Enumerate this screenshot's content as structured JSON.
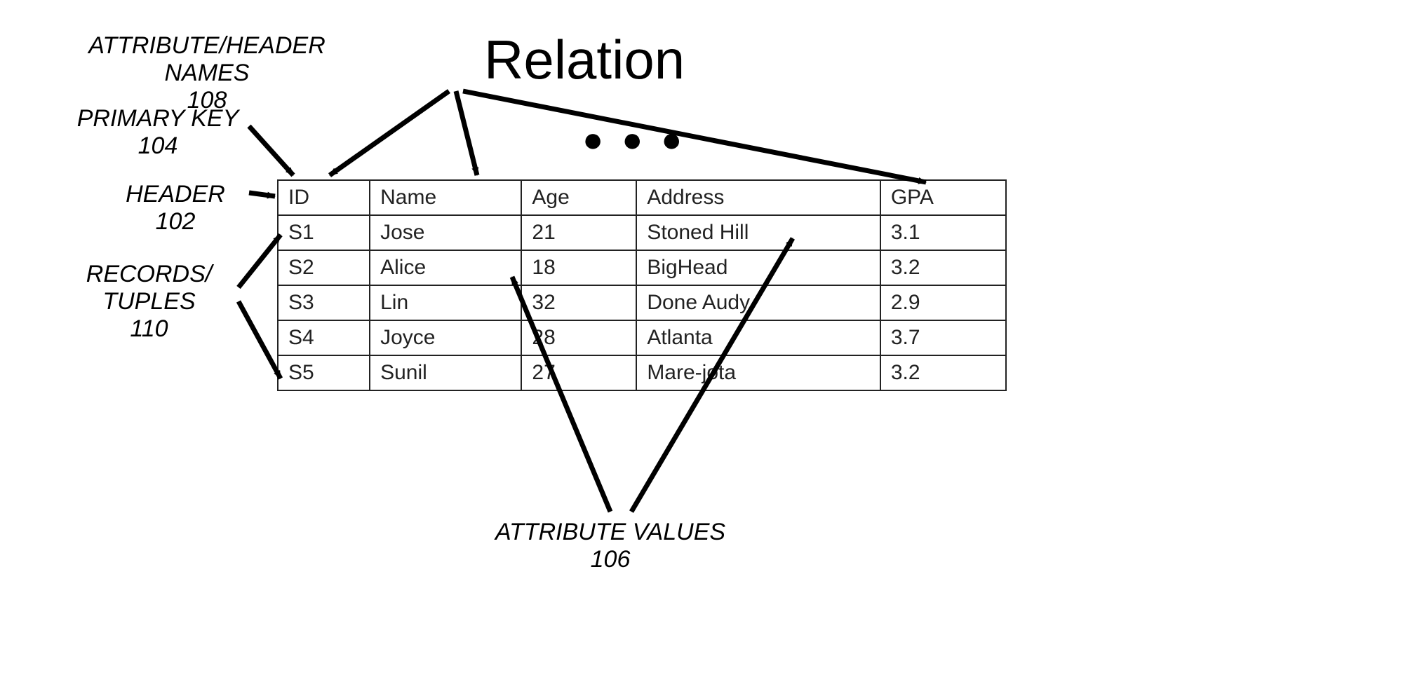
{
  "title": "Relation",
  "ellipsis": "● ● ●",
  "labels": {
    "attr_names": {
      "text": "ATTRIBUTE/HEADER NAMES",
      "num": "108"
    },
    "primary_key": {
      "text": "PRIMARY KEY",
      "num": "104"
    },
    "header": {
      "text": "HEADER",
      "num": "102"
    },
    "records": {
      "text": "RECORDS/\nTUPLES",
      "num": "110"
    },
    "attr_values": {
      "text": "ATTRIBUTE VALUES",
      "num": "106"
    }
  },
  "table": {
    "headers": [
      "ID",
      "Name",
      "Age",
      "Address",
      "GPA"
    ],
    "rows": [
      [
        "S1",
        "Jose",
        "21",
        "Stoned Hill",
        "3.1"
      ],
      [
        "S2",
        "Alice",
        "18",
        "BigHead",
        "3.2"
      ],
      [
        "S3",
        "Lin",
        "32",
        "Done Audy",
        "2.9"
      ],
      [
        "S4",
        "Joyce",
        "28",
        "Atlanta",
        "3.7"
      ],
      [
        "S5",
        "Sunil",
        "27",
        "Mare-jota",
        "3.2"
      ]
    ]
  }
}
